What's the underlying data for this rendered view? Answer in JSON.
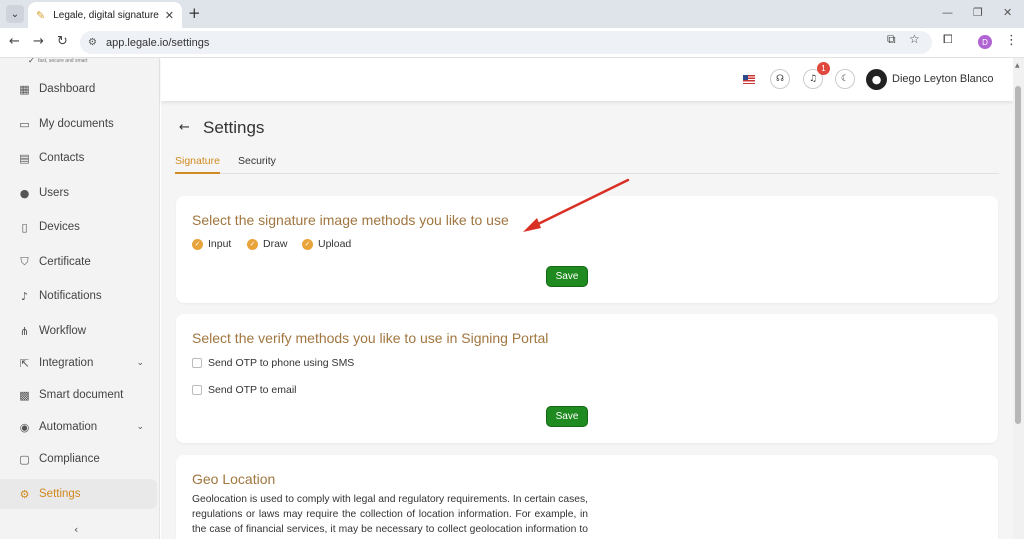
{
  "browser": {
    "tab_title": "Legale, digital signature",
    "new_tab": "+",
    "url": "app.legale.io/settings",
    "profile_initial": "D"
  },
  "logo": {
    "tagline": "fast, secure and smart"
  },
  "sidebar": {
    "items": [
      {
        "label": "Dashboard",
        "icon": "dashboard-icon"
      },
      {
        "label": "My documents",
        "icon": "folder-icon"
      },
      {
        "label": "Contacts",
        "icon": "contacts-icon"
      },
      {
        "label": "Users",
        "icon": "user-icon"
      },
      {
        "label": "Devices",
        "icon": "device-icon"
      },
      {
        "label": "Certificate",
        "icon": "shield-icon"
      },
      {
        "label": "Notifications",
        "icon": "bell-icon"
      },
      {
        "label": "Workflow",
        "icon": "workflow-icon"
      },
      {
        "label": "Integration",
        "icon": "external-link-icon"
      },
      {
        "label": "Smart document",
        "icon": "grid-icon"
      },
      {
        "label": "Automation",
        "icon": "automation-icon"
      },
      {
        "label": "Compliance",
        "icon": "chat-icon"
      },
      {
        "label": "Settings",
        "icon": "gear-icon"
      }
    ],
    "active": "Settings",
    "collapse_glyph": "‹"
  },
  "header": {
    "notification_count": "1",
    "user_name": "Diego Leyton Blanco"
  },
  "page": {
    "title": "Settings",
    "tabs": [
      {
        "label": "Signature"
      },
      {
        "label": "Security"
      }
    ],
    "active_tab": "Signature"
  },
  "signature_card": {
    "title": "Select the signature image methods you like to use",
    "options": [
      {
        "label": "Input",
        "checked": true
      },
      {
        "label": "Draw",
        "checked": true
      },
      {
        "label": "Upload",
        "checked": true
      }
    ],
    "save_label": "Save"
  },
  "verify_card": {
    "title": "Select the verify methods you like to use in Signing Portal",
    "options": [
      {
        "label": "Send OTP to phone using SMS",
        "checked": false
      },
      {
        "label": "Send OTP to email",
        "checked": false
      }
    ],
    "save_label": "Save"
  },
  "geo_card": {
    "title": "Geo Location",
    "text": "Geolocation is used to comply with legal and regulatory requirements. In certain cases, regulations or laws may require the collection of location information. For example, in the case of financial services, it may be necessary to collect geolocation information to comply"
  },
  "colors": {
    "accent": "#d08a1f",
    "card_title": "#a1763f",
    "save_green": "#1f8a1f",
    "badge_red": "#e0483d",
    "annotation_arrow": "#d93025"
  }
}
